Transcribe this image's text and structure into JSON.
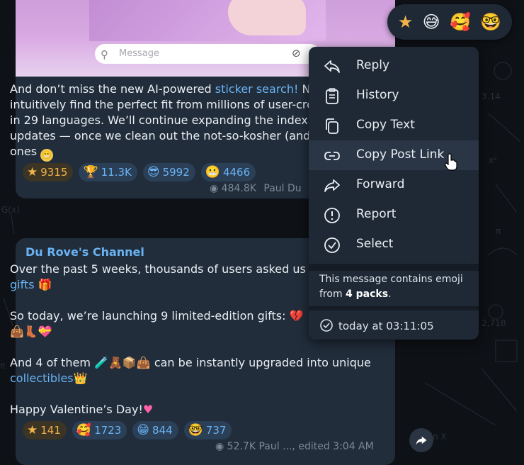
{
  "post_top": {
    "media_message_placeholder": "Message",
    "lines": [
      "intuitively find the perfect fit from millions of user-cre",
      "in 29 languages. We’ll continue expanding the index in",
      "updates — once we clean out the not-so-kosher (and",
      "ones"
    ],
    "line1_prefix": "And don’t miss the new AI-powered ",
    "line1_link": "sticker search!",
    "line1_suffix": " No",
    "reactions": [
      {
        "icon": "star-icon",
        "count": "9315"
      },
      {
        "icon": "trophy-emoji-icon",
        "count": "11.3K"
      },
      {
        "icon": "sunglasses-emoji-icon",
        "count": "5992"
      },
      {
        "icon": "grimace-emoji-icon",
        "count": "4466"
      }
    ],
    "views": "484.8K",
    "author": "Paul Du"
  },
  "post_bottom": {
    "channel": "Du Rove's Channel",
    "line1": "Over the past 5 weeks, thousands of users asked us t",
    "line2_link": "gifts",
    "line3": "So today, we’re launching 9 limited-edition gifts:",
    "line5_prefix": "And 4 of them",
    "line5_suffix": "can be instantly upgraded into unique",
    "line6_link": "collectibles",
    "line7": "Happy Valentine’s Day!",
    "reactions": [
      {
        "icon": "star-icon",
        "count": "141"
      },
      {
        "icon": "heart-hug-emoji-icon",
        "count": "1723"
      },
      {
        "icon": "grin-emoji-icon",
        "count": "844"
      },
      {
        "icon": "nerd-emoji-icon",
        "count": "737"
      }
    ],
    "meta": "52.7K  Paul ..., edited 3:04 AM"
  },
  "reaction_bar": [
    "star-icon",
    "grin-sweat-emoji-icon",
    "heart-hug-emoji-icon",
    "nerd-emoji-icon"
  ],
  "context_menu": {
    "items": [
      {
        "label": "Reply",
        "icon": "reply-icon"
      },
      {
        "label": "History",
        "icon": "clipboard-icon"
      },
      {
        "label": "Copy Text",
        "icon": "copy-icon"
      },
      {
        "label": "Copy Post Link",
        "icon": "link-icon"
      },
      {
        "label": "Forward",
        "icon": "forward-icon"
      },
      {
        "label": "Report",
        "icon": "report-icon"
      },
      {
        "label": "Select",
        "icon": "check-circle-icon"
      }
    ],
    "info_line1": "This message contains emoji",
    "info_line2_prefix": "from ",
    "info_line2_bold": "4 packs",
    "info_line2_suffix": ".",
    "time": "today at 03:11:05"
  },
  "colors": {
    "bubble": "#212d3b",
    "menu": "#1f2935",
    "link": "#6ab3f3",
    "star": "#f0b44a"
  }
}
